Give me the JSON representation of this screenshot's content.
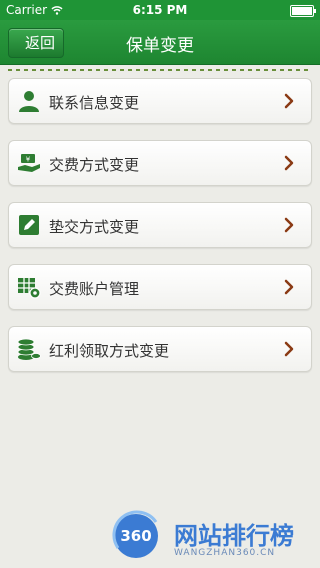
{
  "status_bar": {
    "carrier": "Carrier",
    "time": "6:15 PM"
  },
  "nav": {
    "back_label": "返回",
    "title": "保单变更"
  },
  "menu": [
    {
      "label": "联系信息变更",
      "icon": "person-icon"
    },
    {
      "label": "交费方式变更",
      "icon": "money-hand-icon"
    },
    {
      "label": "垫交方式变更",
      "icon": "edit-icon"
    },
    {
      "label": "交费账户管理",
      "icon": "table-gear-icon"
    },
    {
      "label": "红利领取方式变更",
      "icon": "coins-icon"
    }
  ],
  "watermark": {
    "logo_text": "360",
    "title": "网站排行榜",
    "subtitle": "WANGZHAN360.CN"
  },
  "colors": {
    "brand_green": "#1f9436",
    "chevron": "#8a3a14",
    "icon_green": "#2e7d32"
  }
}
